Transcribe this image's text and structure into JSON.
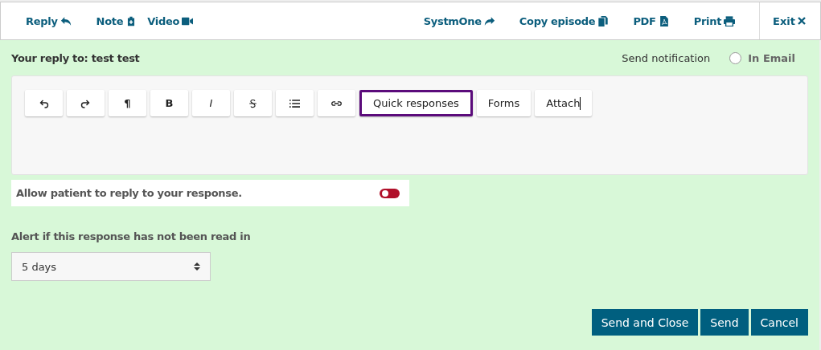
{
  "nav_left": [
    {
      "label": "Reply",
      "kind": "reply"
    },
    {
      "label": "Note",
      "kind": "note"
    },
    {
      "label": "Video",
      "kind": "video"
    }
  ],
  "nav_right": [
    {
      "label": "SystmOne",
      "kind": "share"
    },
    {
      "label": "Copy episode",
      "kind": "copy"
    },
    {
      "label": "PDF",
      "kind": "pdf"
    },
    {
      "label": "Print",
      "kind": "print"
    }
  ],
  "exit": {
    "label": "Exit"
  },
  "reply_to": "Your reply to: test test",
  "notification": {
    "label": "Send notification",
    "option": "In Email",
    "checked": false
  },
  "editor": {
    "tools": [
      {
        "kind": "undo"
      },
      {
        "kind": "redo"
      },
      {
        "kind": "bold",
        "label": "¶"
      },
      {
        "kind": "bold",
        "label": "B"
      },
      {
        "kind": "italic",
        "label": "I"
      },
      {
        "kind": "strike"
      },
      {
        "kind": "list"
      },
      {
        "kind": "link"
      },
      {
        "kind": "text",
        "label": "Quick responses",
        "focused": true,
        "caret": false
      },
      {
        "kind": "text",
        "label": "Forms",
        "focused": false,
        "caret": false
      },
      {
        "kind": "text",
        "label": "Attach",
        "focused": false,
        "caret": true
      }
    ]
  },
  "allow_reply": {
    "label": "Allow patient to reply to your response.",
    "on": false
  },
  "alert": {
    "label": "Alert if this response has not been read in",
    "value": "5 days"
  },
  "buttons": [
    "Send and Close",
    "Send",
    "Cancel"
  ]
}
